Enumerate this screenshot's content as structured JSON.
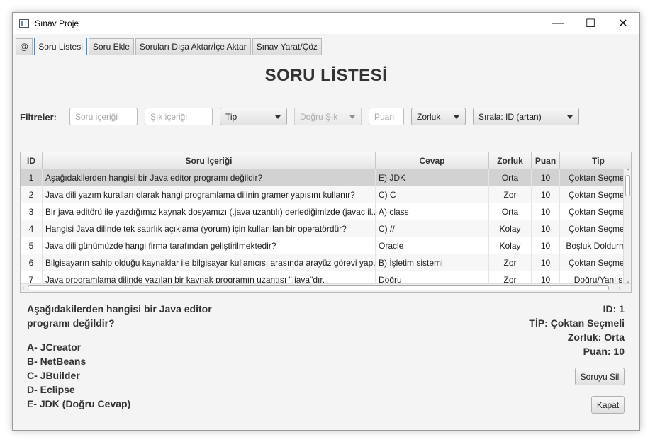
{
  "window": {
    "title": "Sınav Proje"
  },
  "window_controls": {
    "minimize": "—",
    "maximize": "☐",
    "close": "✕"
  },
  "tabs": [
    {
      "label": "@"
    },
    {
      "label": "Soru Listesi",
      "active": true
    },
    {
      "label": "Soru Ekle"
    },
    {
      "label": "Soruları Dışa Aktar/İçe Aktar"
    },
    {
      "label": "Sınav Yarat/Çöz"
    }
  ],
  "page": {
    "title": "SORU LİSTESİ"
  },
  "filters": {
    "label": "Filtreler:",
    "question_placeholder": "Soru içeriği",
    "choice_placeholder": "Şık içeriği",
    "type_combo": "Tip",
    "correct_choice_combo": "Doğru Şık",
    "score_placeholder": "Puan",
    "difficulty_combo": "Zorluk",
    "sort_combo": "Sırala: ID (artan)"
  },
  "table": {
    "headers": [
      "ID",
      "Soru İçeriği",
      "Cevap",
      "Zorluk",
      "Puan",
      "Tip"
    ],
    "rows": [
      {
        "id": "1",
        "question": "Aşağıdakilerden hangisi bir Java editor     programı değildir?",
        "answer": "E) JDK",
        "difficulty": "Orta",
        "score": "10",
        "type": "Çoktan Seçmeli"
      },
      {
        "id": "2",
        "question": "Java dili yazım kuralları olarak hangi programlama dilinin gramer yapısını kullanır?",
        "answer": "C) C",
        "difficulty": "Zor",
        "score": "10",
        "type": "Çoktan Seçmeli"
      },
      {
        "id": "3",
        "question": "Bir java editörü ile yazdığımız kaynak dosyamızı (.java uzantılı) derlediğimizde (javac il...",
        "answer": "A) class",
        "difficulty": "Orta",
        "score": "10",
        "type": "Çoktan Seçmeli"
      },
      {
        "id": "4",
        "question": "Hangisi Java dilinde tek satırlık açıklama (yorum) için kullanılan bir operatördür?",
        "answer": "C) //",
        "difficulty": "Kolay",
        "score": "10",
        "type": "Çoktan Seçmeli"
      },
      {
        "id": "5",
        "question": "Java dili günümüzde hangi firma tarafından geliştirilmektedir?",
        "answer": "Oracle",
        "difficulty": "Kolay",
        "score": "10",
        "type": "Boşluk Doldurma"
      },
      {
        "id": "6",
        "question": "Bilgisayarın sahip olduğu kaynaklar ile bilgisayar kullanıcısı arasında arayüz görevi yap...",
        "answer": "B) İşletim sistemi",
        "difficulty": "Zor",
        "score": "10",
        "type": "Çoktan Seçmeli"
      },
      {
        "id": "7",
        "question": "Java programlama dilinde yazılan bir kaynak programın uzantısı \".java\"dır.",
        "answer": "Doğru",
        "difficulty": "Zor",
        "score": "10",
        "type": "Doğru/Yanlış"
      }
    ],
    "selected_row": 0
  },
  "detail": {
    "question": "Aşağıdakilerden hangisi bir Java editor programı değildir?",
    "choices": [
      "A- JCreator",
      "B- NetBeans",
      "C- JBuilder",
      "D- Eclipse",
      "E- JDK (Doğru Cevap)"
    ],
    "id_text": "ID: 1",
    "type_text": "TİP: Çoktan Seçmeli",
    "difficulty_text": "Zorluk: Orta",
    "score_text": "Puan: 10",
    "delete_button": "Soruyu Sil",
    "close_button": "Kapat"
  }
}
